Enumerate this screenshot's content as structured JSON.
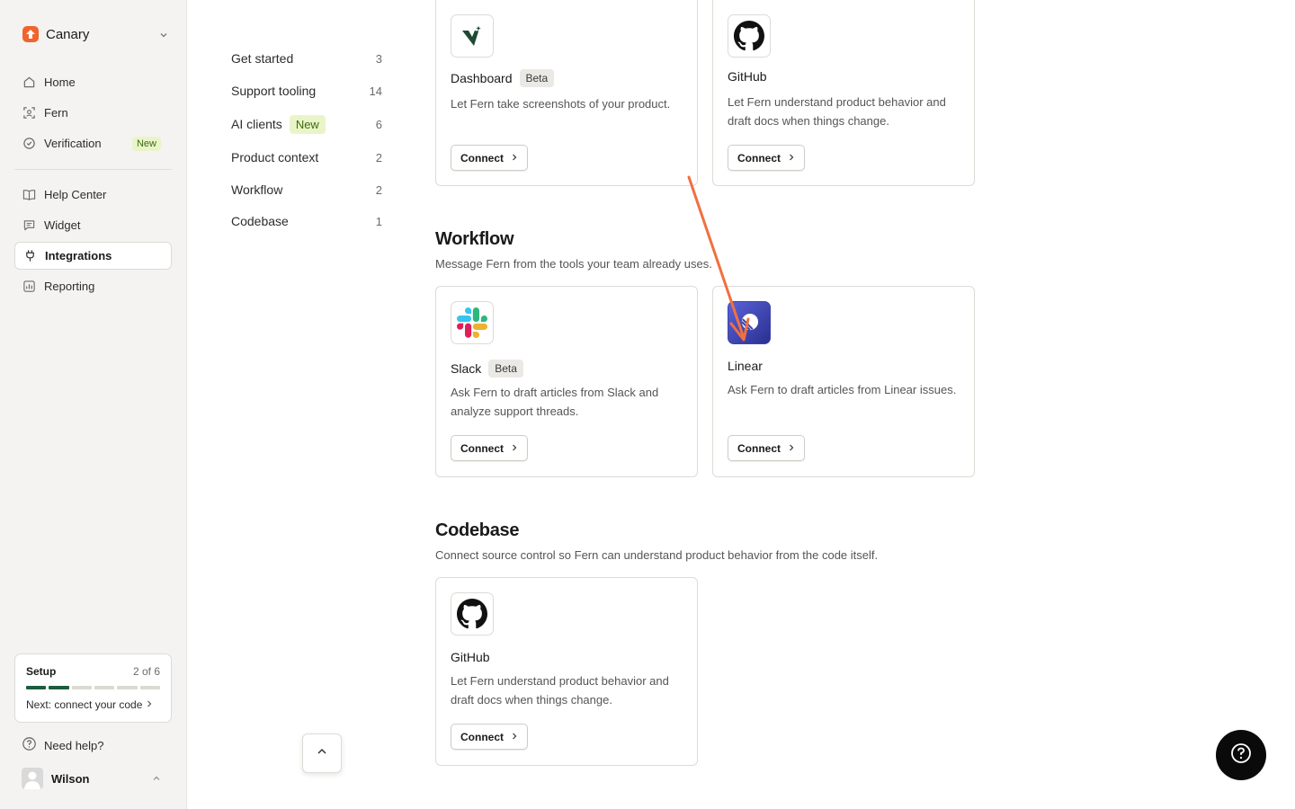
{
  "sidebar": {
    "workspace": "Canary",
    "items": [
      {
        "label": "Home"
      },
      {
        "label": "Fern"
      },
      {
        "label": "Verification",
        "badge": "New"
      },
      {
        "label": "Help Center"
      },
      {
        "label": "Widget"
      },
      {
        "label": "Integrations",
        "active": true
      },
      {
        "label": "Reporting"
      }
    ],
    "setup": {
      "title": "Setup",
      "count": "2 of 6",
      "next": "Next: connect your code",
      "completed_steps": 2,
      "total_steps": 6
    },
    "help": "Need help?",
    "user": "Wilson"
  },
  "categories": [
    {
      "label": "Get started",
      "count": "3"
    },
    {
      "label": "Support tooling",
      "count": "14"
    },
    {
      "label": "AI clients",
      "badge": "New",
      "count": "6"
    },
    {
      "label": "Product context",
      "count": "2"
    },
    {
      "label": "Workflow",
      "count": "2"
    },
    {
      "label": "Codebase",
      "count": "1"
    }
  ],
  "top_cards": [
    {
      "name": "Dashboard",
      "badge": "Beta",
      "desc": "Let Fern take screenshots of your product.",
      "button": "Connect"
    },
    {
      "name": "GitHub",
      "desc": "Let Fern understand product behavior and draft docs when things change.",
      "button": "Connect"
    }
  ],
  "workflow": {
    "title": "Workflow",
    "desc": "Message Fern from the tools your team already uses.",
    "cards": [
      {
        "name": "Slack",
        "badge": "Beta",
        "desc": "Ask Fern to draft articles from Slack and analyze support threads.",
        "button": "Connect"
      },
      {
        "name": "Linear",
        "desc": "Ask Fern to draft articles from Linear issues.",
        "button": "Connect"
      }
    ]
  },
  "codebase": {
    "title": "Codebase",
    "desc": "Connect source control so Fern can understand product behavior from the code itself.",
    "cards": [
      {
        "name": "GitHub",
        "desc": "Let Fern understand product behavior and draft docs when things change.",
        "button": "Connect"
      }
    ]
  },
  "colors": {
    "accent": "#f0642d",
    "annotation_arrow": "#f07040",
    "progress_done": "#1f5c3a",
    "new_badge_bg": "#e9f5c8"
  }
}
